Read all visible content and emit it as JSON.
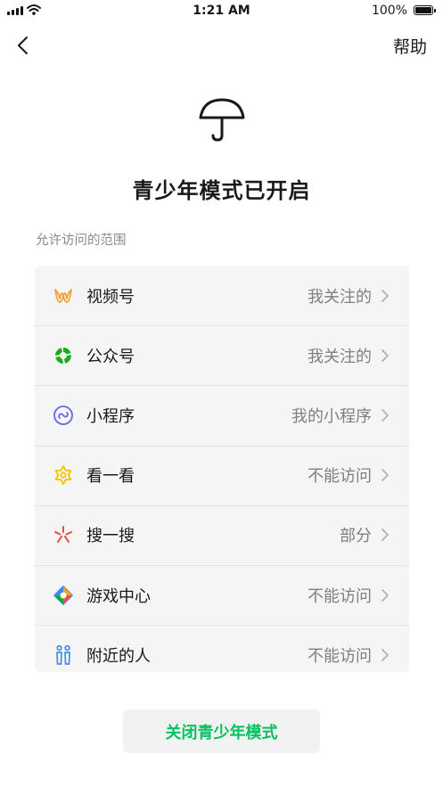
{
  "status_bar": {
    "time": "1:21 AM",
    "battery_text": "100%",
    "battery_level": 1.0
  },
  "nav": {
    "help_label": "帮助",
    "back_icon": "chevron-left-icon"
  },
  "hero": {
    "icon": "umbrella-icon",
    "title": "青少年模式已开启"
  },
  "section_label": "允许访问的范围",
  "items": [
    {
      "label": "视频号",
      "value": "我关注的",
      "icon": "channels-icon",
      "color": "#f0a23a"
    },
    {
      "label": "公众号",
      "value": "我关注的",
      "icon": "official-account-icon",
      "color": "#1aad19"
    },
    {
      "label": "小程序",
      "value": "我的小程序",
      "icon": "mini-program-icon",
      "color": "#6467f0"
    },
    {
      "label": "看一看",
      "value": "不能访问",
      "icon": "top-stories-icon",
      "color": "#f5c400"
    },
    {
      "label": "搜一搜",
      "value": "部分",
      "icon": "search-icon",
      "color": "#e84a3f"
    },
    {
      "label": "游戏中心",
      "value": "不能访问",
      "icon": "game-center-icon",
      "color": "#e8563f"
    },
    {
      "label": "附近的人",
      "value": "不能访问",
      "icon": "people-nearby-icon",
      "color": "#3b8ee8"
    }
  ],
  "close_button_label": "关闭青少年模式",
  "colors": {
    "accent": "#07c160",
    "list_bg": "#f5f5f5"
  }
}
